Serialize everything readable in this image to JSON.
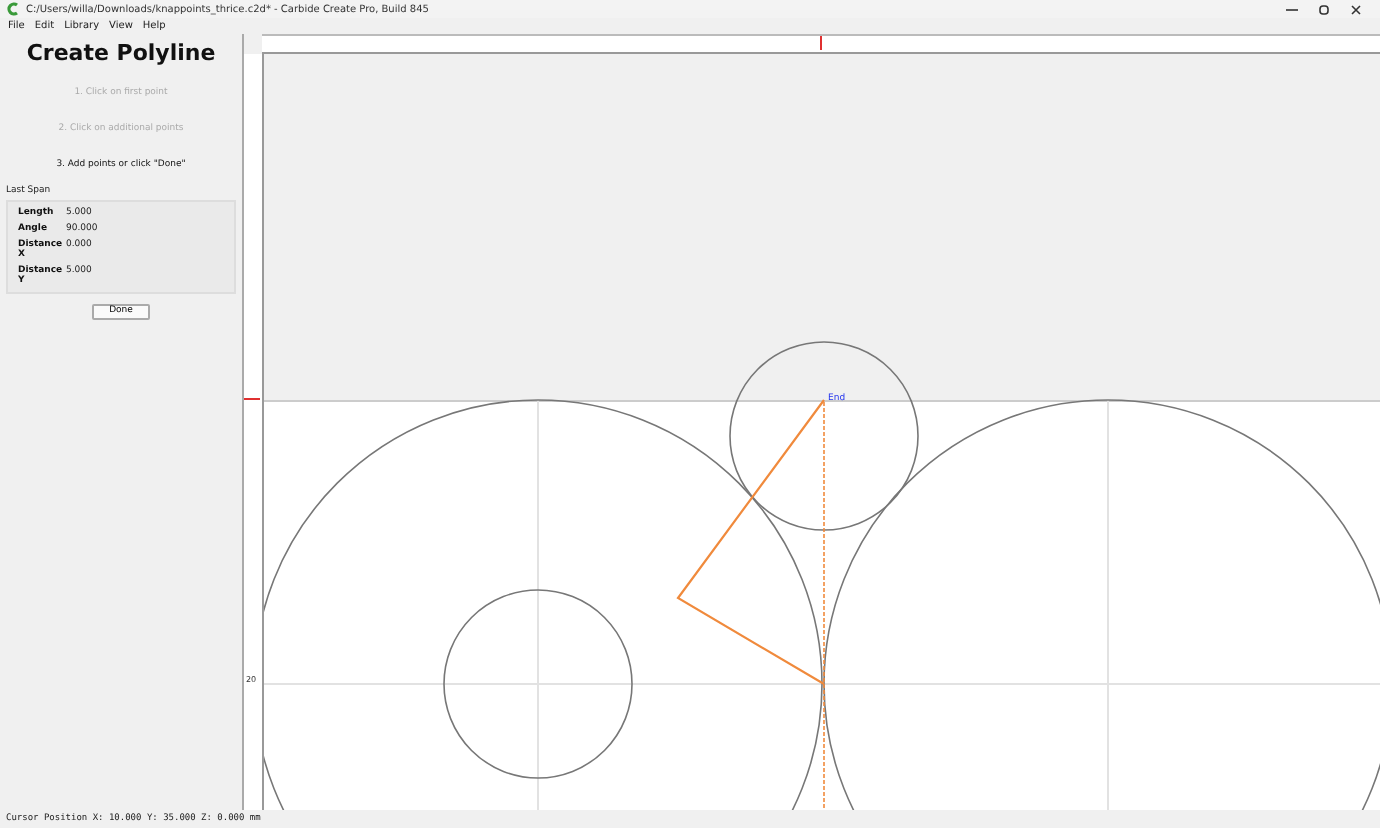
{
  "window": {
    "title": "C:/Users/willa/Downloads/knappoints_thrice.c2d* - Carbide Create Pro, Build 845"
  },
  "menu": [
    "File",
    "Edit",
    "Library",
    "View",
    "Help"
  ],
  "panel": {
    "title": "Create Polyline",
    "steps": [
      {
        "text": "1. Click on first point",
        "active": false
      },
      {
        "text": "2. Click on additional points",
        "active": false
      },
      {
        "text": "3. Add points or click \"Done\"",
        "active": true
      }
    ],
    "group_title": "Last Span",
    "rows": [
      {
        "label": "Length",
        "value": "5.000"
      },
      {
        "label": "Angle",
        "value": "90.000"
      },
      {
        "label": "Distance X",
        "value": "0.000"
      },
      {
        "label": "Distance Y",
        "value": "5.000"
      }
    ],
    "button": "Done"
  },
  "canvas": {
    "end_label": "End",
    "ruler_label": "20"
  },
  "status_bar": "Cursor Position X: 10.000 Y: 35.000 Z: 0.000 mm"
}
